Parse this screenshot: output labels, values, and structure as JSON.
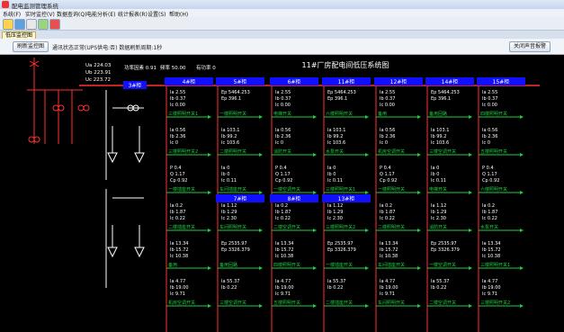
{
  "window": {
    "title": "配电监测管理系统"
  },
  "menu": [
    "系统(F)",
    "实时监控(V)",
    "数据查询(Q)",
    "电能分析(E)",
    "统计报表(R)",
    "设置(S)",
    "帮助(H)"
  ],
  "tabs": [
    {
      "label": "低压监控图"
    }
  ],
  "actions": {
    "refresh_label": "刷新监控图",
    "status_text": "通讯状态正常(UPS供电:否)  数据刷新周期:1秒",
    "alarm_label": "关闭声音报警"
  },
  "diagram": {
    "title": "11#厂房配电间低压系统图",
    "incoming": {
      "voltages": [
        "Ua 224.03",
        "Ub 223.91",
        "Uc 223.72"
      ],
      "load_label": "功率因素 0.91",
      "freq_label": "频率 50.00",
      "eff_label": "有功率 0"
    },
    "cabinets_row1": [
      "3#柜",
      "4#柜",
      "5#柜",
      "6#柜",
      "11#柜",
      "12#柜",
      "14#柜",
      "15#柜"
    ],
    "cabinets_row2": [
      "7#柜",
      "8#柜",
      "13#柜"
    ],
    "transformer_label": "3#柜",
    "colors": {
      "bus": "#ff3030",
      "header": "#1010ff",
      "value": "#ffffff",
      "green": "#22cc44"
    }
  },
  "readings": [
    [
      "Ia 2.55",
      "Ib 0.37",
      "Ic 0.00"
    ],
    [
      "Ia 0.56",
      "Ib 2.36",
      "Ic 0"
    ],
    [
      "P 0.4",
      "Q 1.17",
      "Cp 0.92"
    ],
    [
      "Ia 0.2",
      "Ib 1.87",
      "Ic 0.22"
    ],
    [
      "Ia 13.34",
      "Ib 15.72",
      "Ic 10.38"
    ],
    [
      "Ia 4.77",
      "Ib 19.00",
      "Ic 9.71"
    ],
    [
      "Ep 5464.253",
      "Ep 396.1"
    ],
    [
      "Ia 103.1",
      "Ib 99.2",
      "Ic 103.6"
    ],
    [
      "Ia 0",
      "Ib 0",
      "Ic 0.11"
    ],
    [
      "Ia 1.12",
      "Ib 1.29",
      "Ic 2.30"
    ],
    [
      "Ep 2535.97",
      "Ep 3326.379"
    ],
    [
      "Ia 55.37",
      "Ib 0.22"
    ]
  ],
  "feeder_labels": [
    "三楼照明开关1",
    "三楼照明开关2",
    "一楼插座开关",
    "二楼插座开关",
    "备用",
    "机房空调开关",
    "一楼照明开关",
    "二楼照明开关",
    "车间插座开关",
    "车间照明开关",
    "备用回路",
    "三楼空调开关",
    "电梯开关",
    "消防开关",
    "一楼空调开关",
    "二楼空调开关",
    "四楼照明开关",
    "五楼照明开关",
    "六楼照明开关",
    "水泵开关"
  ]
}
